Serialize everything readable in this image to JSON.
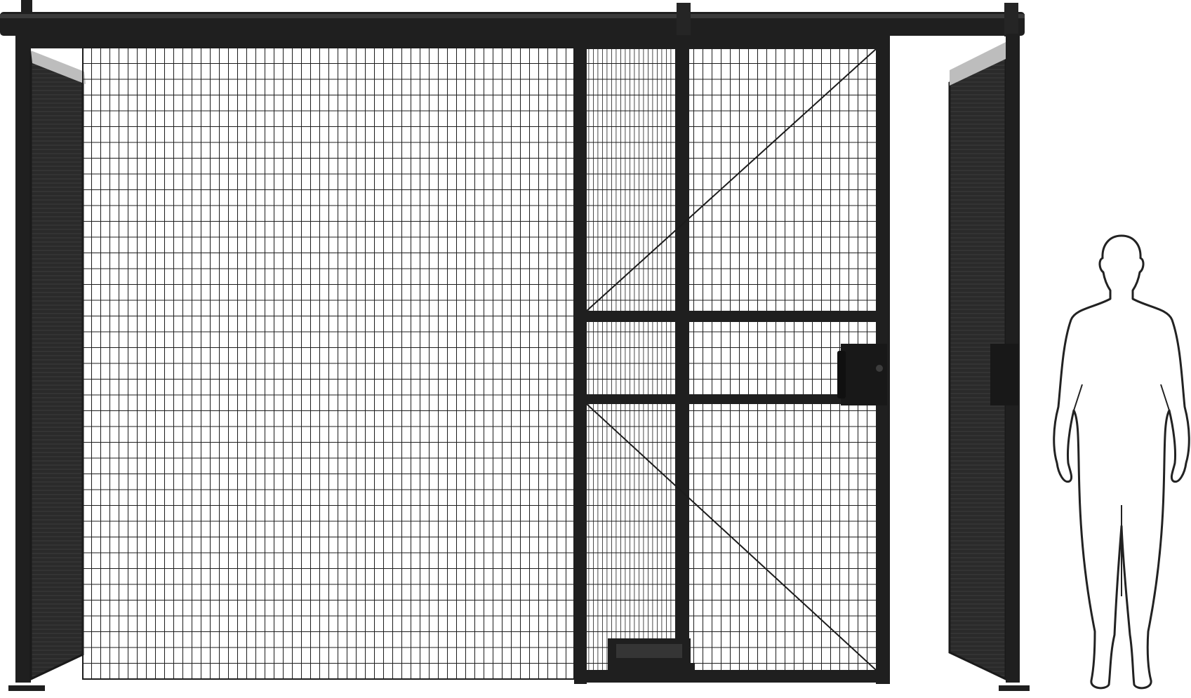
{
  "scene": {
    "colors": {
      "background": "#ffffff",
      "frame": "#1f1f1f",
      "frame_highlight": "#3a3a3a",
      "mesh": "#1c1c1c",
      "panel_fill": "#2a2a2a",
      "cap": "#bdbdbd",
      "silhouette_stroke": "#222222",
      "silhouette_fill": "#ffffff"
    },
    "components": [
      "top-track-rail",
      "left-side-panel",
      "fixed-mesh-panel",
      "sliding-door",
      "door-lock",
      "door-handle",
      "right-side-panel",
      "right-lock-receiver",
      "human-silhouette"
    ]
  }
}
